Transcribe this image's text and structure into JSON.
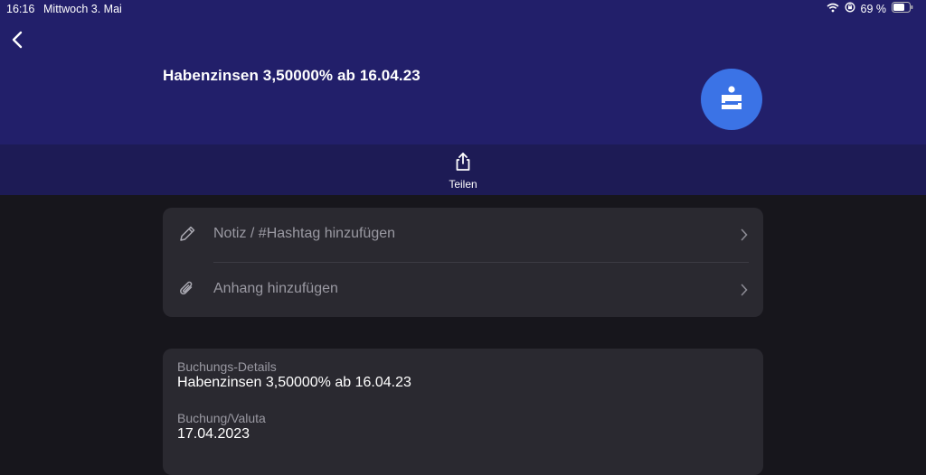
{
  "status_bar": {
    "time": "16:16",
    "date": "Mittwoch 3. Mai",
    "battery": "69 %"
  },
  "header": {
    "title": "Habenzinsen 3,50000% ab 16.04.23",
    "logo_icon": "sparkasse-icon"
  },
  "share": {
    "label": "Teilen",
    "icon": "share-icon"
  },
  "actions": [
    {
      "label": "Notiz / #Hashtag hinzufügen",
      "icon": "pencil-icon"
    },
    {
      "label": "Anhang hinzufügen",
      "icon": "paperclip-icon"
    }
  ],
  "details": [
    {
      "label": "Buchungs-Details",
      "value": "Habenzinsen 3,50000% ab 16.04.23"
    },
    {
      "label": "Buchung/Valuta",
      "value": "17.04.2023"
    }
  ],
  "colors": {
    "header_bg": "#221f6a",
    "sharebar_bg": "#1d1b55",
    "page_bg": "#17161c",
    "card_bg": "#2a2930",
    "accent": "#3b73e6"
  }
}
